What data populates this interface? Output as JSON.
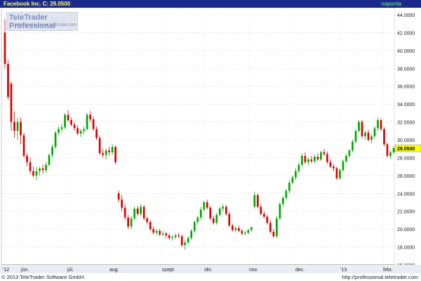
{
  "header": {
    "title": "Facebook Inc.  C: 29.0500",
    "period": "naponta",
    "title_color": "#ffff66",
    "period_color": "#66ff66",
    "bar_color": "#1a2a8a"
  },
  "logo": {
    "name": "TeleTrader Professional",
    "url": "http://professional.teletrader.com"
  },
  "footer": {
    "copyright": "© 2013 TeleTrader Software GmbH",
    "url": "http://professional.teletrader.com"
  },
  "chart_data": {
    "type": "candlestick",
    "up_color": "#00aa00",
    "down_color": "#dd0000",
    "last_price_label": "29.0500",
    "ylim": [
      16,
      44
    ],
    "y_ticks": [
      "16.0000",
      "18.0000",
      "20.0000",
      "22.0000",
      "24.0000",
      "26.0000",
      "28.0000",
      "30.0000",
      "32.0000",
      "34.0000",
      "36.0000",
      "38.0000",
      "40.0000",
      "42.0000",
      "44.0000"
    ],
    "x_labels": [
      "'12",
      "jún.",
      "júl.",
      "aug.",
      "szept.",
      "okt.",
      "nov.",
      "dec.",
      "'13",
      "febr."
    ],
    "grid": true,
    "candles": [
      [
        42.0,
        43.5,
        38.0,
        38.5
      ],
      [
        38.5,
        39.0,
        34.5,
        34.8
      ],
      [
        36.3,
        36.5,
        31.0,
        32.0
      ],
      [
        32.0,
        33.2,
        30.2,
        31.0
      ],
      [
        31.0,
        32.5,
        30.0,
        32.0
      ],
      [
        32.0,
        32.5,
        29.5,
        30.5
      ],
      [
        30.5,
        30.8,
        28.0,
        28.2
      ],
      [
        28.2,
        28.5,
        27.0,
        27.5
      ],
      [
        27.5,
        28.0,
        26.2,
        26.5
      ],
      [
        26.5,
        27.0,
        25.8,
        26.0
      ],
      [
        26.0,
        27.0,
        25.5,
        26.5
      ],
      [
        26.5,
        27.0,
        26.0,
        26.8
      ],
      [
        26.8,
        27.2,
        26.2,
        26.6
      ],
      [
        26.6,
        27.5,
        26.3,
        27.2
      ],
      [
        27.2,
        28.5,
        27.0,
        28.3
      ],
      [
        28.3,
        29.5,
        28.0,
        29.2
      ],
      [
        29.2,
        31.0,
        29.0,
        30.8
      ],
      [
        30.8,
        31.5,
        30.5,
        31.2
      ],
      [
        31.2,
        31.8,
        30.8,
        31.4
      ],
      [
        31.4,
        33.0,
        31.2,
        32.8
      ],
      [
        32.8,
        33.3,
        32.0,
        32.2
      ],
      [
        32.2,
        32.5,
        31.5,
        31.7
      ],
      [
        31.7,
        32.0,
        31.0,
        31.3
      ],
      [
        31.3,
        31.6,
        30.5,
        30.7
      ],
      [
        30.7,
        31.2,
        30.3,
        31.0
      ],
      [
        31.0,
        31.5,
        30.6,
        31.2
      ],
      [
        31.2,
        33.0,
        31.0,
        32.8
      ],
      [
        32.8,
        33.2,
        32.0,
        32.3
      ],
      [
        32.3,
        32.6,
        31.0,
        31.2
      ],
      [
        31.2,
        31.5,
        30.0,
        30.2
      ],
      [
        30.2,
        30.5,
        28.3,
        28.5
      ],
      [
        28.5,
        29.0,
        28.0,
        28.3
      ],
      [
        28.3,
        29.0,
        27.8,
        28.8
      ],
      [
        28.8,
        29.2,
        28.2,
        28.6
      ],
      [
        28.6,
        29.5,
        28.3,
        29.2
      ],
      [
        29.2,
        29.4,
        27.2,
        27.5
      ],
      [
        24.0,
        24.3,
        23.0,
        23.3
      ],
      [
        23.3,
        23.8,
        22.0,
        22.4
      ],
      [
        22.4,
        22.8,
        21.0,
        21.3
      ],
      [
        21.3,
        21.6,
        20.0,
        20.3
      ],
      [
        20.3,
        21.5,
        20.0,
        21.2
      ],
      [
        21.2,
        22.5,
        21.0,
        22.3
      ],
      [
        22.3,
        22.6,
        21.5,
        21.7
      ],
      [
        21.7,
        22.8,
        21.5,
        22.5
      ],
      [
        22.5,
        22.7,
        21.0,
        21.2
      ],
      [
        21.2,
        21.4,
        20.5,
        20.8
      ],
      [
        20.8,
        21.0,
        19.8,
        20.0
      ],
      [
        20.0,
        20.3,
        19.4,
        19.6
      ],
      [
        19.6,
        20.0,
        19.3,
        19.8
      ],
      [
        19.8,
        20.0,
        19.2,
        19.4
      ],
      [
        19.4,
        19.8,
        19.2,
        19.5
      ],
      [
        19.5,
        19.7,
        19.0,
        19.3
      ],
      [
        19.3,
        19.5,
        18.8,
        19.0
      ],
      [
        19.0,
        19.3,
        18.7,
        19.1
      ],
      [
        19.1,
        19.5,
        18.9,
        19.3
      ],
      [
        19.3,
        19.6,
        19.0,
        19.2
      ],
      [
        19.2,
        19.4,
        18.0,
        18.2
      ],
      [
        18.2,
        18.8,
        17.7,
        18.5
      ],
      [
        18.5,
        19.2,
        18.3,
        19.0
      ],
      [
        19.0,
        20.0,
        18.8,
        19.8
      ],
      [
        19.8,
        21.0,
        19.6,
        20.8
      ],
      [
        20.8,
        21.5,
        20.5,
        21.3
      ],
      [
        21.3,
        22.5,
        21.0,
        22.2
      ],
      [
        22.2,
        23.2,
        22.0,
        23.0
      ],
      [
        23.0,
        23.3,
        22.2,
        22.4
      ],
      [
        22.4,
        22.6,
        21.0,
        21.2
      ],
      [
        21.2,
        21.5,
        20.5,
        20.7
      ],
      [
        20.7,
        21.8,
        20.5,
        21.6
      ],
      [
        21.6,
        22.5,
        21.4,
        22.3
      ],
      [
        22.3,
        22.8,
        22.0,
        22.5
      ],
      [
        22.5,
        22.7,
        21.5,
        21.7
      ],
      [
        21.7,
        21.9,
        20.2,
        20.4
      ],
      [
        20.4,
        20.6,
        19.7,
        19.9
      ],
      [
        19.9,
        20.3,
        19.6,
        20.1
      ],
      [
        20.1,
        20.4,
        19.7,
        19.8
      ],
      [
        19.8,
        20.0,
        19.3,
        19.5
      ],
      [
        19.5,
        19.8,
        19.3,
        19.6
      ],
      [
        19.6,
        20.0,
        19.4,
        19.9
      ],
      [
        19.9,
        20.3,
        19.7,
        20.2
      ],
      [
        22.5,
        24.2,
        22.3,
        23.8
      ],
      [
        23.8,
        24.0,
        22.3,
        22.5
      ],
      [
        22.5,
        22.8,
        21.5,
        21.7
      ],
      [
        21.7,
        22.0,
        21.2,
        21.4
      ],
      [
        21.4,
        21.6,
        20.5,
        20.7
      ],
      [
        20.7,
        21.0,
        19.5,
        19.7
      ],
      [
        19.7,
        20.0,
        19.0,
        19.2
      ],
      [
        19.2,
        21.5,
        19.0,
        21.2
      ],
      [
        21.2,
        23.0,
        21.0,
        22.8
      ],
      [
        22.8,
        23.7,
        22.5,
        23.5
      ],
      [
        23.5,
        24.5,
        23.3,
        24.3
      ],
      [
        24.3,
        25.5,
        24.0,
        25.2
      ],
      [
        25.2,
        26.0,
        25.0,
        25.8
      ],
      [
        25.8,
        26.8,
        25.5,
        26.5
      ],
      [
        26.5,
        27.5,
        26.3,
        27.2
      ],
      [
        27.2,
        28.5,
        27.0,
        28.2
      ],
      [
        28.2,
        28.6,
        27.3,
        27.5
      ],
      [
        27.5,
        28.0,
        27.2,
        27.8
      ],
      [
        27.8,
        28.2,
        27.4,
        27.6
      ],
      [
        27.6,
        28.3,
        27.4,
        28.1
      ],
      [
        28.1,
        28.5,
        27.6,
        27.8
      ],
      [
        27.8,
        28.8,
        27.6,
        28.6
      ],
      [
        28.6,
        29.0,
        28.2,
        28.4
      ],
      [
        28.4,
        28.7,
        27.3,
        27.5
      ],
      [
        27.5,
        27.8,
        26.8,
        27.0
      ],
      [
        27.0,
        27.3,
        26.5,
        26.8
      ],
      [
        26.8,
        27.0,
        25.5,
        25.7
      ],
      [
        25.7,
        26.8,
        25.5,
        26.6
      ],
      [
        26.6,
        27.8,
        26.4,
        27.6
      ],
      [
        27.6,
        28.4,
        27.4,
        28.2
      ],
      [
        28.2,
        29.0,
        28.0,
        28.8
      ],
      [
        28.8,
        30.0,
        28.6,
        29.8
      ],
      [
        29.8,
        31.2,
        29.6,
        31.0
      ],
      [
        31.0,
        32.2,
        30.8,
        32.0
      ],
      [
        32.0,
        32.2,
        30.2,
        30.4
      ],
      [
        30.4,
        31.0,
        30.0,
        30.8
      ],
      [
        30.8,
        31.1,
        29.8,
        30.0
      ],
      [
        30.0,
        30.6,
        29.6,
        30.4
      ],
      [
        30.4,
        31.5,
        30.2,
        31.3
      ],
      [
        31.3,
        32.5,
        31.0,
        32.2
      ],
      [
        32.2,
        32.4,
        31.0,
        31.2
      ],
      [
        31.2,
        31.4,
        29.3,
        29.5
      ],
      [
        29.5,
        29.7,
        28.0,
        28.2
      ],
      [
        28.2,
        28.8,
        27.9,
        28.6
      ],
      [
        28.6,
        29.3,
        28.4,
        29.05
      ]
    ]
  }
}
